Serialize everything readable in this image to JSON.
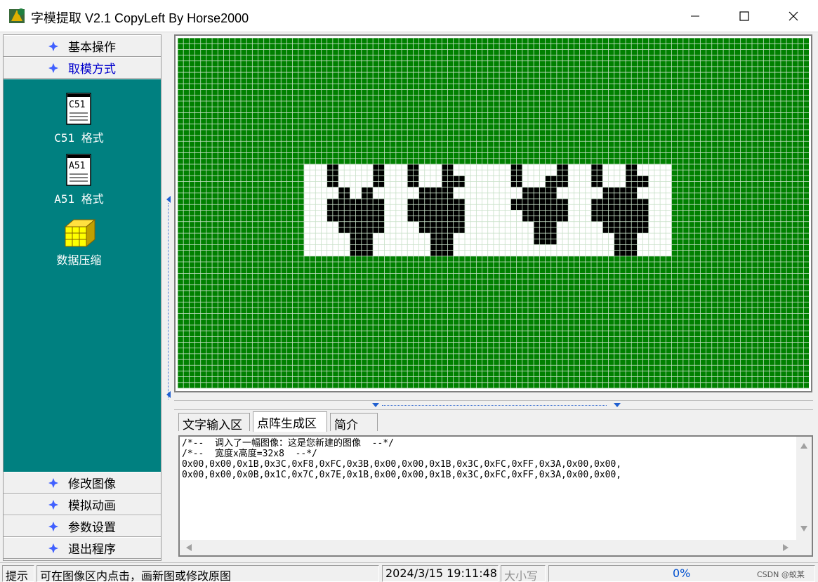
{
  "window": {
    "title": "字模提取 V2.1  CopyLeft By Horse2000"
  },
  "sidebar": {
    "top_buttons": [
      {
        "label": "基本操作"
      },
      {
        "label": "取模方式"
      }
    ],
    "tools": [
      {
        "label": "C51 格式",
        "icon_text": "C51"
      },
      {
        "label": "A51 格式",
        "icon_text": "A51"
      },
      {
        "label": "数据压缩"
      }
    ],
    "bottom_buttons": [
      {
        "label": "修改图像"
      },
      {
        "label": "模拟动画"
      },
      {
        "label": "参数设置"
      },
      {
        "label": "退出程序"
      }
    ]
  },
  "tabs": [
    {
      "label": "文字输入区"
    },
    {
      "label": "点阵生成区"
    },
    {
      "label": "简介"
    }
  ],
  "code": {
    "line1": "/*--  调入了一幅图像：这是您新建的图像  --*/",
    "line2": "/*--  宽度x高度=32x8  --*/",
    "line3": "0x00,0x00,0x1B,0x3C,0xF8,0xFC,0x3B,0x00,0x00,0x1B,0x3C,0xFC,0xFF,0x3A,0x00,0x00,",
    "line4": "0x00,0x00,0x0B,0x1C,0x7C,0x7E,0x1B,0x00,0x00,0x1B,0x3C,0xFC,0xFF,0x3A,0x00,0x00,"
  },
  "status": {
    "hint_label": "提示",
    "hint_text": "可在图像区内点击，画新图或修改原图",
    "datetime": "2024/3/15 19:11:48",
    "caps": "大小写",
    "progress": "0%"
  },
  "watermark": "CSDN @蚁某",
  "pixel_image": {
    "width": 32,
    "height": 8,
    "bytes": [
      0,
      0,
      27,
      60,
      248,
      252,
      59,
      0,
      0,
      27,
      60,
      252,
      255,
      58,
      0,
      0,
      0,
      0,
      11,
      28,
      124,
      126,
      27,
      0,
      0,
      27,
      60,
      252,
      255,
      58,
      0,
      0
    ]
  },
  "colors": {
    "grid_background": "#008000",
    "image_background": "#ffffff",
    "pixel_on": "#000000",
    "sidebar": "#008080",
    "active_nav": "#0000cc"
  }
}
